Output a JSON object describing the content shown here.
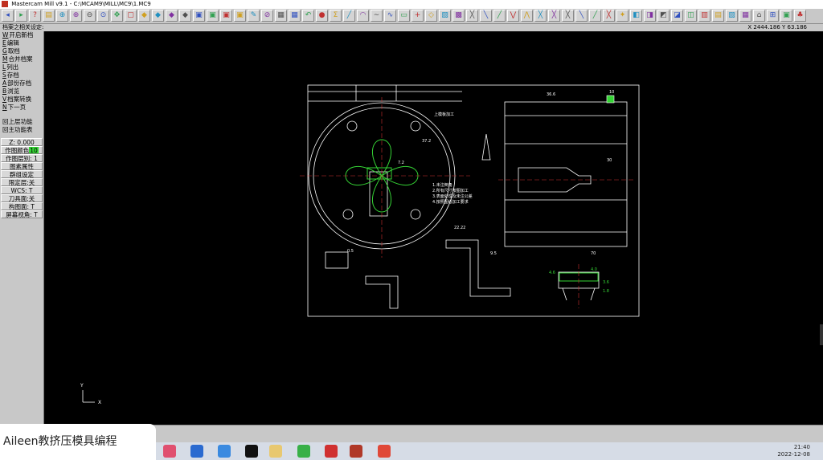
{
  "window": {
    "title": "Mastercam Mill v9.1 - C:\\MCAM9\\MILL\\MC9\\1.MC9"
  },
  "toolbar": {
    "icons": [
      "back-arrow",
      "forward-arrow",
      "help",
      "file",
      "zoom-window",
      "zoom-in",
      "zoom-out",
      "zoom-fit",
      "pan",
      "select",
      "view-top",
      "view-front",
      "view-side",
      "view-iso",
      "view-cube",
      "view-cube-2",
      "view-cube-3",
      "view-cube-4",
      "eraser",
      "delete",
      "transform",
      "transform-2",
      "undo",
      "sphere",
      "sigma",
      "line",
      "arc",
      "curve",
      "spline",
      "rectangle",
      "plus",
      "chamfer",
      "surface",
      "solid",
      "xform-1",
      "xform-2",
      "xform-3",
      "xform-4",
      "xform-5",
      "xform-6",
      "xform-7",
      "xform-8",
      "xform-9",
      "xform-10",
      "xform-11",
      "toolpath-1",
      "toolpath-2",
      "toolpath-3",
      "toolpath-4",
      "toolpath-5",
      "toolpath-6",
      "toolpath-7",
      "toolpath-8",
      "toolpath-9",
      "toolpath-10",
      "toolpath-11",
      "toolpath-12",
      "toolpath-13",
      "toolpath-14"
    ]
  },
  "status": {
    "left": "档案之相关设定:",
    "coords": "X 2444.186  Y 63.186"
  },
  "menu": {
    "items": [
      {
        "key": "W",
        "label": "开启新档"
      },
      {
        "key": "E",
        "label": "编辑"
      },
      {
        "key": "G",
        "label": "取档"
      },
      {
        "key": "M",
        "label": "合并档案"
      },
      {
        "key": "L",
        "label": "列出"
      },
      {
        "key": "S",
        "label": "存档"
      },
      {
        "key": "A",
        "label": "部份存档"
      },
      {
        "key": "B",
        "label": "浏览"
      },
      {
        "key": "V",
        "label": "档案转换"
      },
      {
        "key": "N",
        "label": "下一页"
      }
    ],
    "back": "回上层功能",
    "main": "回主功能表",
    "z": "Z:  0.000",
    "color_label": "作图颜色",
    "color_value": "10",
    "level": "作图层别: 1",
    "attr": "图素属性",
    "group": "群组设定",
    "limit": "限定层:关",
    "wcs": "WCS: T",
    "tool": "刀具面:关",
    "cplane": "构图面: T",
    "screen": "屏幕视角: T"
  },
  "axis": {
    "y": "Y",
    "x": "X"
  },
  "drawing": {
    "top_note": "上模板加工",
    "notes": [
      "1.未注倒角",
      "2.所有尺寸按图加工",
      "3.表面处理及未注公差",
      "4.按照图纸加工要求"
    ],
    "dims": [
      "36.6",
      "37.2",
      "7.2",
      "30",
      "70",
      "10",
      "22.22",
      "9.5",
      "0.5",
      "4.6",
      "4.0",
      "3.6",
      "1.8"
    ]
  },
  "watermark": "Aileen教挤压模具编程",
  "clock": {
    "time": "21:40",
    "date": "2022-12-08"
  },
  "colors": {
    "title_bar": "#ffffff",
    "chrome": "#c8c8c8",
    "canvas": "#000000",
    "accent_green": "#35d435"
  }
}
